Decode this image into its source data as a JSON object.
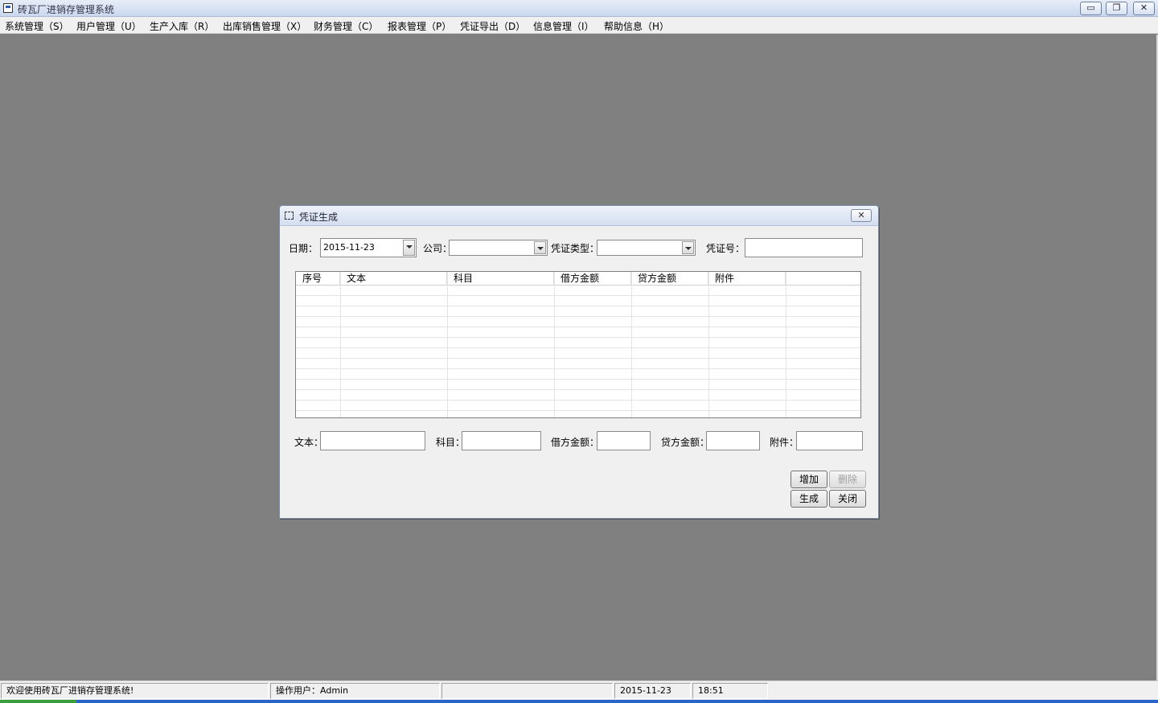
{
  "window": {
    "title": "砖瓦厂进销存管理系统",
    "buttons": {
      "minimize": "▭",
      "restore": "❐",
      "close": "✕"
    }
  },
  "menu": [
    "系统管理（S）",
    "用户管理（U）",
    "生产入库（R）",
    "出库销售管理（X）",
    "财务管理（C）",
    "报表管理（P）",
    "凭证导出（D）",
    "信息管理（I）",
    "帮助信息（H）"
  ],
  "dialog": {
    "title": "凭证生成",
    "close_glyph": "✕",
    "filters": {
      "date_label": "日期：",
      "date_value": "2015-11-23",
      "company_label": "公司：",
      "company_value": "",
      "voucher_type_label": "凭证类型：",
      "voucher_type_value": "",
      "voucher_no_label": "凭证号：",
      "voucher_no_value": ""
    },
    "grid": {
      "columns": [
        "序号",
        "文本",
        "科目",
        "借方金额",
        "贷方金额",
        "附件",
        ""
      ],
      "rows": []
    },
    "editor": {
      "text_label": "文本：",
      "text_value": "",
      "subject_label": "科目：",
      "subject_value": "",
      "debit_label": "借方金额：",
      "debit_value": "",
      "credit_label": "贷方金额：",
      "credit_value": "",
      "attachment_label": "附件：",
      "attachment_value": ""
    },
    "buttons": {
      "add": "增加",
      "delete": "删除",
      "generate": "生成",
      "close": "关闭"
    }
  },
  "statusbar": {
    "welcome": "欢迎使用砖瓦厂进销存管理系统!",
    "user": "操作用户：Admin",
    "blank": "",
    "date": "2015-11-23",
    "time": "18:51"
  },
  "colors": {
    "desktop": "#808080",
    "title_gradient_top": "#e8eef8",
    "dialog_bg": "#f0f0f0"
  }
}
